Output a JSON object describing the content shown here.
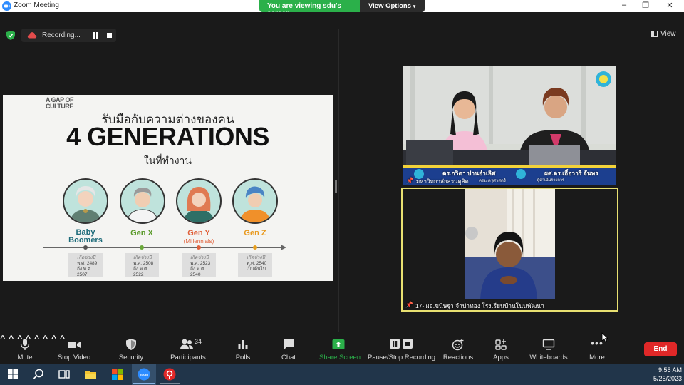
{
  "window": {
    "title": "Zoom Meeting",
    "controls": [
      "–",
      "❐",
      "✕"
    ]
  },
  "share_banner": {
    "message": "You are viewing sdu's screen",
    "options_label": "View Options"
  },
  "recording": {
    "status": "Recording..."
  },
  "view_button": "View",
  "slide": {
    "brand": "A GAP OF CULTURE",
    "title_line1": "รับมือกับความต่างของคน",
    "title_line2": "4 GENERATIONS",
    "title_line3": "ในที่ทำงาน",
    "generations": [
      {
        "label": "Baby Boomers",
        "sub": "",
        "color": "#1d6b7a",
        "from": "พ.ศ. 2489",
        "to": "ถึง พ.ศ. 2507",
        "dot": "#555555"
      },
      {
        "label": "Gen X",
        "sub": "",
        "color": "#5a9a2a",
        "from": "พ.ศ. 2508",
        "to": "ถึง พ.ศ. 2522",
        "dot": "#6aa83a"
      },
      {
        "label": "Gen Y",
        "sub": "(Millennials)",
        "color": "#e0603a",
        "from": "พ.ศ. 2523",
        "to": "ถึง พ.ศ. 2540",
        "dot": "#e0603a"
      },
      {
        "label": "Gen Z",
        "sub": "",
        "color": "#e89a20",
        "from": "พ.ศ. 2540",
        "to": "เป็นต้นไป",
        "dot": "#e8a020"
      }
    ],
    "year_prefix": "เกิดช่วงปี"
  },
  "video1": {
    "name_left": "ดร.กวิตา ปานอำเลิศ",
    "name_right": "ผศ.ดร.เอื้อวารี จันทร",
    "caption": "มหาวิทยาลัยสวนดุสิต",
    "caption_right": "คณะครุศาสตร์",
    "caption_small": "ผู้ดำเนินรายการ"
  },
  "video2": {
    "name": "17- ผอ.ขนิษฐา จำปาทอง โรงเรียนบ้านโนนพัฒนา"
  },
  "toolbar": {
    "items": [
      {
        "label": "Mute",
        "icon": "microphone-icon"
      },
      {
        "label": "Stop Video",
        "icon": "video-camera-icon"
      },
      {
        "label": "Security",
        "icon": "shield-icon"
      },
      {
        "label": "Participants",
        "icon": "participants-icon",
        "count": "34"
      },
      {
        "label": "Polls",
        "icon": "polls-icon"
      },
      {
        "label": "Chat",
        "icon": "chat-icon"
      },
      {
        "label": "Share Screen",
        "icon": "share-screen-icon"
      },
      {
        "label": "Pause/Stop Recording",
        "icon": "pause-stop-icon"
      },
      {
        "label": "Reactions",
        "icon": "reactions-icon"
      },
      {
        "label": "Apps",
        "icon": "apps-icon"
      },
      {
        "label": "Whiteboards",
        "icon": "whiteboard-icon"
      },
      {
        "label": "More",
        "icon": "more-icon"
      }
    ],
    "end_label": "End"
  },
  "taskbar": {
    "time": "9:55 AM",
    "date": "5/25/2023"
  },
  "colors": {
    "share_green": "#2bb04a",
    "end_red": "#e02828",
    "active_border": "#e8e071",
    "zoom_blue": "#2d8cff"
  }
}
